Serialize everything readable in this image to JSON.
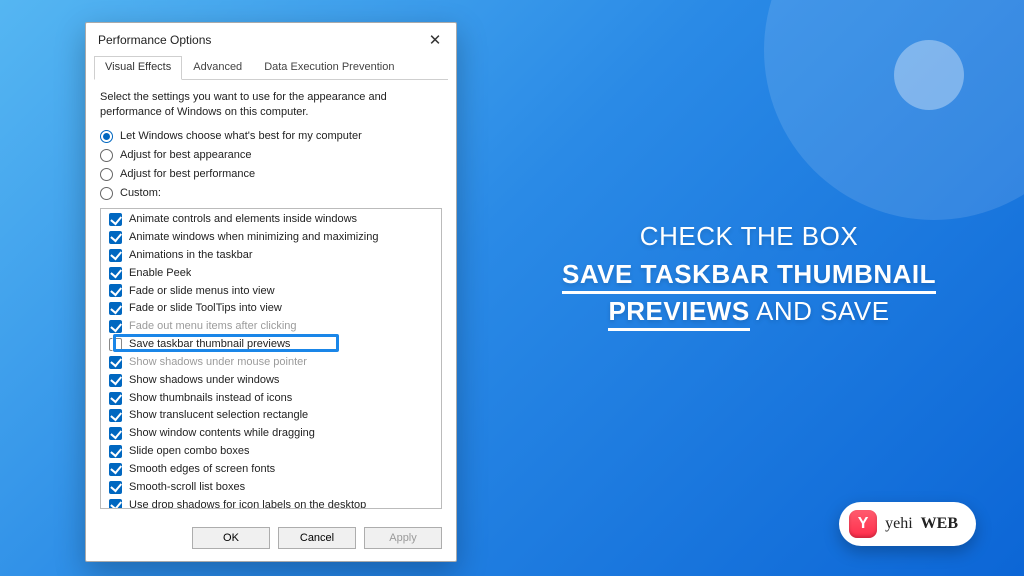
{
  "window": {
    "title": "Performance Options",
    "tabs": [
      {
        "label": "Visual Effects",
        "active": true
      },
      {
        "label": "Advanced",
        "active": false
      },
      {
        "label": "Data Execution Prevention",
        "active": false
      }
    ],
    "description": "Select the settings you want to use for the appearance and performance of Windows on this computer.",
    "radios": [
      {
        "label": "Let Windows choose what's best for my computer",
        "selected": true
      },
      {
        "label": "Adjust for best appearance",
        "selected": false
      },
      {
        "label": "Adjust for best performance",
        "selected": false
      },
      {
        "label": "Custom:",
        "selected": false
      }
    ],
    "options": [
      {
        "label": "Animate controls and elements inside windows",
        "checked": true,
        "faded": false
      },
      {
        "label": "Animate windows when minimizing and maximizing",
        "checked": true,
        "faded": false
      },
      {
        "label": "Animations in the taskbar",
        "checked": true,
        "faded": false
      },
      {
        "label": "Enable Peek",
        "checked": true,
        "faded": false
      },
      {
        "label": "Fade or slide menus into view",
        "checked": true,
        "faded": false
      },
      {
        "label": "Fade or slide ToolTips into view",
        "checked": true,
        "faded": false
      },
      {
        "label": "Fade out menu items after clicking",
        "checked": true,
        "faded": true
      },
      {
        "label": "Save taskbar thumbnail previews",
        "checked": false,
        "faded": false,
        "highlight": true
      },
      {
        "label": "Show shadows under mouse pointer",
        "checked": true,
        "faded": true
      },
      {
        "label": "Show shadows under windows",
        "checked": true,
        "faded": false
      },
      {
        "label": "Show thumbnails instead of icons",
        "checked": true,
        "faded": false
      },
      {
        "label": "Show translucent selection rectangle",
        "checked": true,
        "faded": false
      },
      {
        "label": "Show window contents while dragging",
        "checked": true,
        "faded": false
      },
      {
        "label": "Slide open combo boxes",
        "checked": true,
        "faded": false
      },
      {
        "label": "Smooth edges of screen fonts",
        "checked": true,
        "faded": false
      },
      {
        "label": "Smooth-scroll list boxes",
        "checked": true,
        "faded": false
      },
      {
        "label": "Use drop shadows for icon labels on the desktop",
        "checked": true,
        "faded": false
      }
    ],
    "buttons": {
      "ok": "OK",
      "cancel": "Cancel",
      "apply": "Apply"
    }
  },
  "headline": {
    "line1": "CHECK THE BOX",
    "emph1": "SAVE TASKBAR THUMBNAIL",
    "emph2": "PREVIEWS",
    "tail": " AND SAVE"
  },
  "badge": {
    "icon_letter": "Y",
    "part1": "yehi",
    "part2": "WEB"
  }
}
